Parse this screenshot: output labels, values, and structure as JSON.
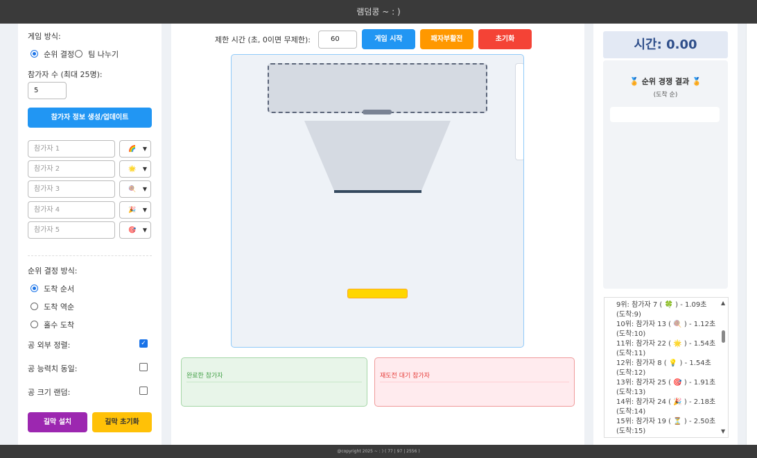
{
  "app": {
    "title": "램덤콩 ~ : )",
    "footer": "@copyright 2025 ~ : ) ( 77 | 97 | 2556 )"
  },
  "left": {
    "game_mode_label": "게임 방식:",
    "mode_options": [
      "순위 결정",
      "팀 나누기"
    ],
    "count_label": "참가자 수 (최대 25명):",
    "count_value": "5",
    "generate_button": "참가자 정보 생성/업데이트",
    "participants": [
      {
        "placeholder": "참가자 1",
        "emoji": "🌈"
      },
      {
        "placeholder": "참가자 2",
        "emoji": "🌟"
      },
      {
        "placeholder": "참가자 3",
        "emoji": "🍭"
      },
      {
        "placeholder": "참가자 4",
        "emoji": "🎉"
      },
      {
        "placeholder": "참가자 5",
        "emoji": "🎯"
      }
    ],
    "rank_method_label": "순위 결정 방식:",
    "rank_methods": [
      "도착 순서",
      "도착 역순",
      "홀수 도착"
    ],
    "options": [
      {
        "label": "공 외부 정렬:",
        "checked": true
      },
      {
        "label": "공 능력치 동일:",
        "checked": false
      },
      {
        "label": "공 크기 랜덤:",
        "checked": false
      }
    ],
    "install_button": "길막 설치",
    "reset_block_button": "길막 초기화"
  },
  "center": {
    "time_limit_label": "제한 시간 (초, 0이면 무제한):",
    "time_limit_value": "60",
    "start_button": "게임 시작",
    "revive_button": "패자부활전",
    "reset_button": "초기화",
    "completed_label": "완료한 참가자",
    "waiting_label": "재도전 대기 참가자"
  },
  "right": {
    "timer": "시간: 0.00",
    "results_title": "🏅 순위 경쟁 결과 🏅",
    "results_subtitle": "(도착 순)",
    "ranks": [
      {
        "line": "9위: 참가자 7 ( 🍀 ) - 1.09초",
        "sub": "(도착:9)"
      },
      {
        "line": "10위: 참가자 13 ( 🍭 ) - 1.12초",
        "sub": "(도착:10)"
      },
      {
        "line": "11위: 참가자 22 ( 🌟 ) - 1.54초",
        "sub": "(도착:11)"
      },
      {
        "line": "12위: 참가자 8 ( 💡 ) - 1.54초",
        "sub": "(도착:12)"
      },
      {
        "line": "13위: 참가자 25 ( 🎯 ) - 1.91초",
        "sub": "(도착:13)"
      },
      {
        "line": "14위: 참가자 24 ( 🎉 ) - 2.18초",
        "sub": "(도착:14)"
      },
      {
        "line": "15위: 참가자 19 ( ⏳ ) - 2.50초",
        "sub": "(도착:15)"
      }
    ]
  },
  "colors": {
    "accent": "#2196f3",
    "orange": "#ff9800",
    "red": "#f44336",
    "purple": "#9c27b0",
    "yellow": "#ffc107",
    "gold": "#ffd600"
  }
}
